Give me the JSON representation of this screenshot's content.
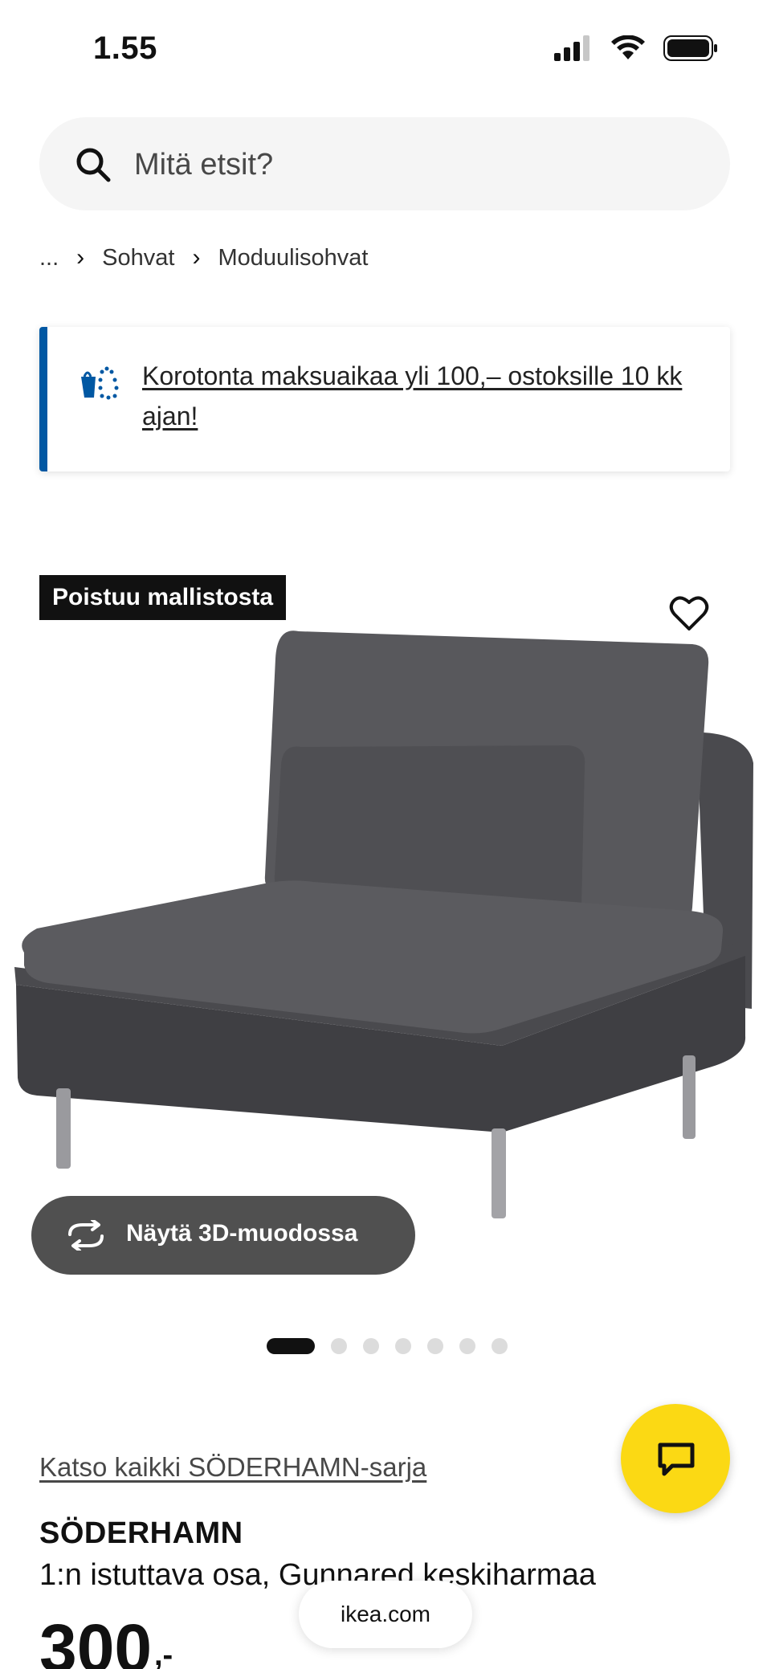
{
  "status_bar": {
    "time": "1.55"
  },
  "search": {
    "placeholder": "Mitä etsit?"
  },
  "breadcrumb": {
    "ellipsis": "...",
    "items": [
      "Sohvat",
      "Moduulisohvat"
    ]
  },
  "promo_banner": {
    "text": "Korotonta maksuaikaa yli 100,– ostoksille 10 kk ajan!",
    "accent_color": "#0058a3"
  },
  "product_image": {
    "badge": "Poistuu mallistosta",
    "view_3d_label": "Näytä 3D-muodossa",
    "carousel": {
      "total": 7,
      "active_index": 0
    }
  },
  "product": {
    "series_link": "Katso kaikki SÖDERHAMN-sarja",
    "name": "SÖDERHAMN",
    "description": "1:n istuttava osa, Gunnared keskiharmaa",
    "price": "300",
    "price_suffix": ",-"
  },
  "chat": {
    "color": "#fbd914",
    "icon": "chat-bubble-icon"
  },
  "browser": {
    "url": "ikea.com"
  }
}
